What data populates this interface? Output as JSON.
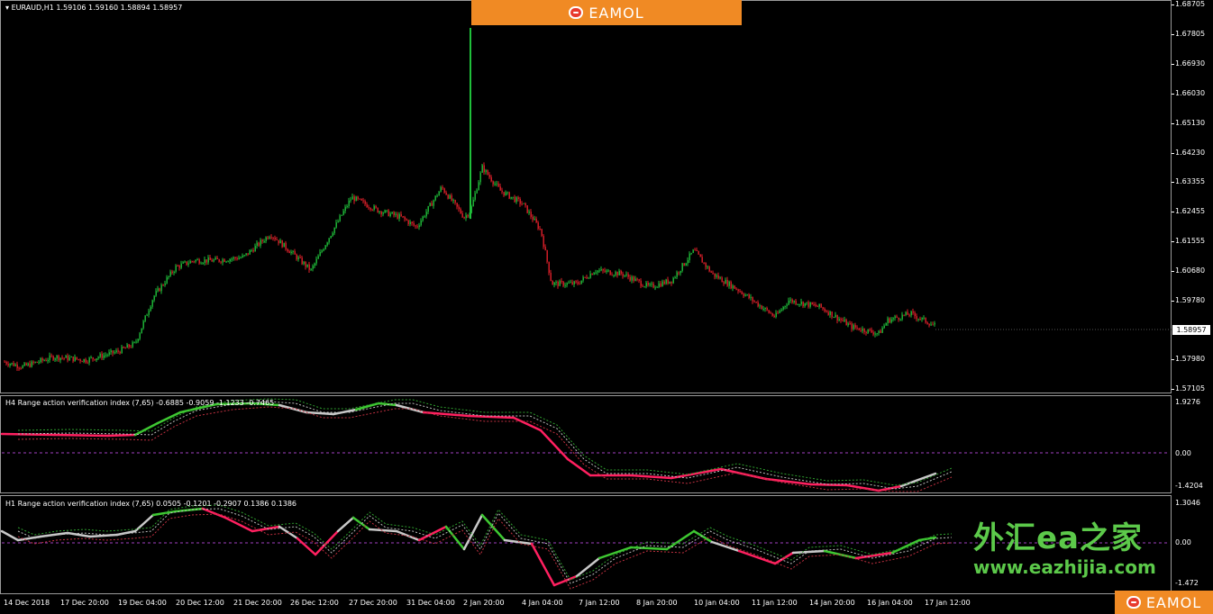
{
  "header": {
    "symbol_line": "EURAUD,H1  1.59106 1.59160 1.58894 1.58957"
  },
  "price_axis": {
    "labels": [
      "1.68705",
      "1.67805",
      "1.66930",
      "1.66030",
      "1.65130",
      "1.64230",
      "1.63355",
      "1.62455",
      "1.61555",
      "1.60680",
      "1.59780",
      "1.57980",
      "1.57105"
    ],
    "current_price": "1.58957"
  },
  "h4_indicator": {
    "title": "H4 Range action verification index (7,65) -0.6885 -0.9059 -1.1233 -0.7465",
    "scale": [
      "1.9276",
      "0.00",
      "-1.4204"
    ]
  },
  "h1_indicator": {
    "title": "H1 Range action verification index (7,65) 0.0505 -0.1201 -0.2907 0.1386 0.1386",
    "scale": [
      "1.3046",
      "0.00",
      "-1.472"
    ]
  },
  "time_axis": [
    "14 Dec 2018",
    "17 Dec 20:00",
    "19 Dec 04:00",
    "20 Dec 12:00",
    "21 Dec 20:00",
    "26 Dec 12:00",
    "27 Dec 20:00",
    "31 Dec 04:00",
    "2 Jan 20:00",
    "4 Jan 04:00",
    "7 Jan 12:00",
    "8 Jan 20:00",
    "10 Jan 04:00",
    "11 Jan 12:00",
    "14 Jan 20:00",
    "16 Jan 04:00",
    "17 Jan 12:00"
  ],
  "logos": {
    "top": "EAMOL",
    "bottom": "EAMOL"
  },
  "watermark": {
    "chinese": "外汇ea之家",
    "url": "www.eazhijia.com"
  },
  "colors": {
    "bull": "#1fbf3a",
    "bear": "#e0202a",
    "oscillator_up": "#3ec832",
    "oscillator_down": "#ff2060",
    "oscillator_neutral": "#c8c8c8",
    "zero_line": "#a040c0",
    "logo_bg": "#f08a24",
    "watermark": "#5cc94a"
  },
  "chart_data": {
    "type": "candlestick",
    "series": [
      {
        "name": "EURAUD,H1",
        "x": [
          "14 Dec 2018",
          "17 Dec 20:00",
          "19 Dec 04:00",
          "20 Dec 12:00",
          "21 Dec 20:00",
          "26 Dec 12:00",
          "27 Dec 20:00",
          "31 Dec 04:00",
          "2 Jan 20:00",
          "4 Jan 04:00",
          "7 Jan 12:00",
          "8 Jan 20:00",
          "10 Jan 04:00",
          "11 Jan 12:00",
          "14 Jan 20:00",
          "16 Jan 04:00",
          "17 Jan 12:00"
        ],
        "close": [
          1.579,
          1.58,
          1.582,
          1.612,
          1.613,
          1.615,
          1.626,
          1.632,
          1.635,
          1.627,
          1.604,
          1.604,
          1.609,
          1.598,
          1.593,
          1.588,
          1.5896
        ]
      }
    ],
    "ylim": [
      1.57105,
      1.68705
    ]
  }
}
